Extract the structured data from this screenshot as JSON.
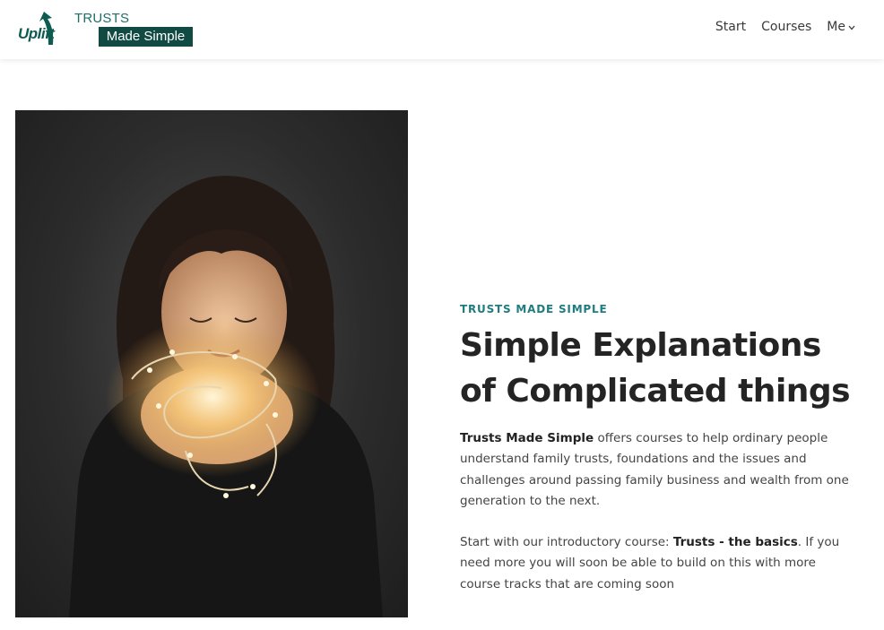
{
  "brand": {
    "logo_word": "Uplift",
    "title_top": "TRUSTS",
    "title_bottom": "Made Simple",
    "colors": {
      "teal": "#1f7c80",
      "dark_green": "#114a43"
    }
  },
  "nav": {
    "items": [
      {
        "label": "Start"
      },
      {
        "label": "Courses"
      },
      {
        "label": "Me",
        "icon": "chevron-down-icon"
      }
    ]
  },
  "hero": {
    "image_alt": "Woman holding glowing fairy lights",
    "eyebrow": "TRUSTS MADE SIMPLE",
    "headline_line1": "Simple Explanations",
    "headline_line2": "of Complicated things",
    "para1_bold": "Trusts Made Simple",
    "para1_rest": " offers courses to help ordinary people understand family trusts, foundations and the issues and challenges around passing family business and wealth from one generation to the next.",
    "para2_start": "Start with our introductory course: ",
    "para2_bold": "Trusts - the basics",
    "para2_rest": ". If you need more you will soon be able to build on this with more course tracks that are coming soon"
  }
}
